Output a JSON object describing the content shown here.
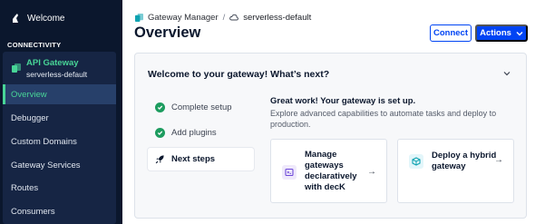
{
  "sidebar": {
    "welcome_label": "Welcome",
    "section_label": "CONNECTIVITY",
    "gateway": {
      "title": "API Gateway",
      "subtitle": "serverless-default"
    },
    "items": [
      {
        "label": "Overview",
        "active": true
      },
      {
        "label": "Debugger",
        "active": false
      },
      {
        "label": "Custom Domains",
        "active": false
      },
      {
        "label": "Gateway Services",
        "active": false
      },
      {
        "label": "Routes",
        "active": false
      },
      {
        "label": "Consumers",
        "active": false
      }
    ]
  },
  "header": {
    "breadcrumb": {
      "root": "Gateway Manager",
      "separator": "/",
      "current": "serverless-default"
    },
    "title": "Overview",
    "connect_label": "Connect",
    "actions_label": "Actions"
  },
  "card": {
    "title": "Welcome to your gateway! What’s next?",
    "steps": [
      {
        "label": "Complete setup",
        "icon": "check-circle-icon"
      },
      {
        "label": "Add plugins",
        "icon": "check-circle-icon"
      },
      {
        "label": "Next steps",
        "icon": "rocket-icon"
      }
    ],
    "content": {
      "title": "Great work! Your gateway is set up.",
      "description": "Explore advanced capabilities to automate tasks and deploy to production.",
      "options": [
        {
          "label": "Manage gateways declaratively with decK",
          "icon": "deck-icon",
          "arrow": "→"
        },
        {
          "label": "Deploy a hybrid gateway",
          "icon": "hybrid-gateway-icon",
          "arrow": "→"
        }
      ]
    }
  },
  "colors": {
    "sidebar_bg": "#0b172d",
    "accent_green": "#48d597",
    "primary_blue": "#0044f4"
  }
}
